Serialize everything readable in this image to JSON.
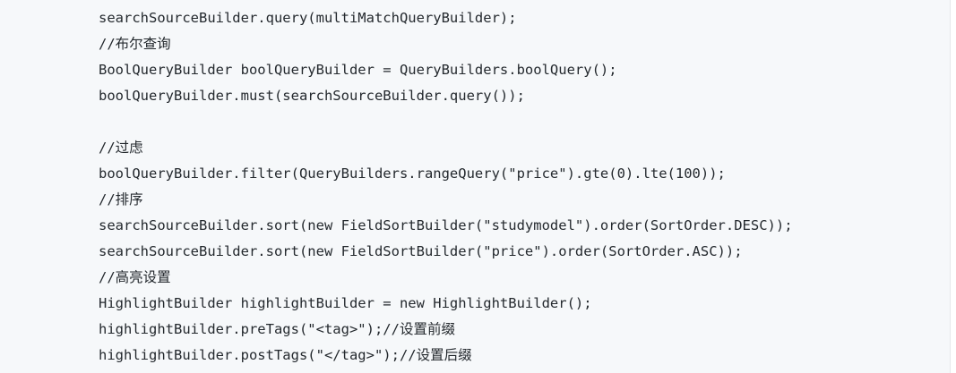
{
  "code_block": {
    "lines": [
      "searchSourceBuilder.query(multiMatchQueryBuilder);",
      "//布尔查询",
      "BoolQueryBuilder boolQueryBuilder = QueryBuilders.boolQuery();",
      "boolQueryBuilder.must(searchSourceBuilder.query());",
      "",
      "//过虑",
      "boolQueryBuilder.filter(QueryBuilders.rangeQuery(\"price\").gte(0).lte(100));",
      "//排序",
      "searchSourceBuilder.sort(new FieldSortBuilder(\"studymodel\").order(SortOrder.DESC));",
      "searchSourceBuilder.sort(new FieldSortBuilder(\"price\").order(SortOrder.ASC));",
      "//高亮设置",
      "HighlightBuilder highlightBuilder = new HighlightBuilder();",
      "highlightBuilder.preTags(\"<tag>\");//设置前缀",
      "highlightBuilder.postTags(\"</tag>\");//设置后缀"
    ]
  }
}
